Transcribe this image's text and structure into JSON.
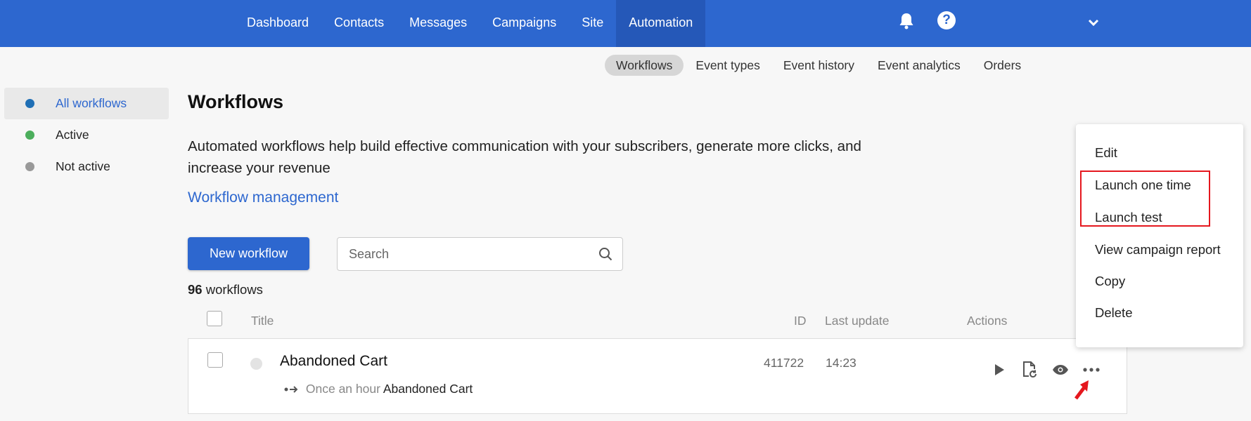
{
  "nav": {
    "items": [
      "Dashboard",
      "Contacts",
      "Messages",
      "Campaigns",
      "Site",
      "Automation"
    ],
    "active": "Automation"
  },
  "subnav": {
    "items": [
      "Workflows",
      "Event types",
      "Event history",
      "Event analytics",
      "Orders"
    ],
    "active": "Workflows"
  },
  "sidebar": {
    "items": [
      {
        "label": "All workflows",
        "dot_color": "#1f6fb5"
      },
      {
        "label": "Active",
        "dot_color": "#4cae5c"
      },
      {
        "label": "Not active",
        "dot_color": "#999999"
      }
    ]
  },
  "page": {
    "title": "Workflows",
    "description": "Automated workflows help build effective communication with your subscribers, generate more clicks, and increase your revenue",
    "management_link": "Workflow management",
    "new_button": "New workflow",
    "search_placeholder": "Search",
    "count_number": "96",
    "count_label": "workflows"
  },
  "table": {
    "headers": {
      "title": "Title",
      "id": "ID",
      "last_update": "Last update",
      "actions": "Actions"
    },
    "rows": [
      {
        "title": "Abandoned Cart",
        "schedule": "Once an hour",
        "schedule_name": "Abandoned Cart",
        "id": "411722",
        "last_update": "14:23",
        "status": "not-active",
        "actions": [
          "play-icon",
          "restart-document-icon",
          "eye-icon",
          "more-icon"
        ]
      }
    ]
  },
  "menu": {
    "items": [
      "Edit",
      "Launch one time",
      "Launch test",
      "View campaign report",
      "Copy",
      "Delete"
    ]
  },
  "colors": {
    "brand": "#2d67cf",
    "nav_active": "#2558b8",
    "highlight": "#e5171e"
  }
}
